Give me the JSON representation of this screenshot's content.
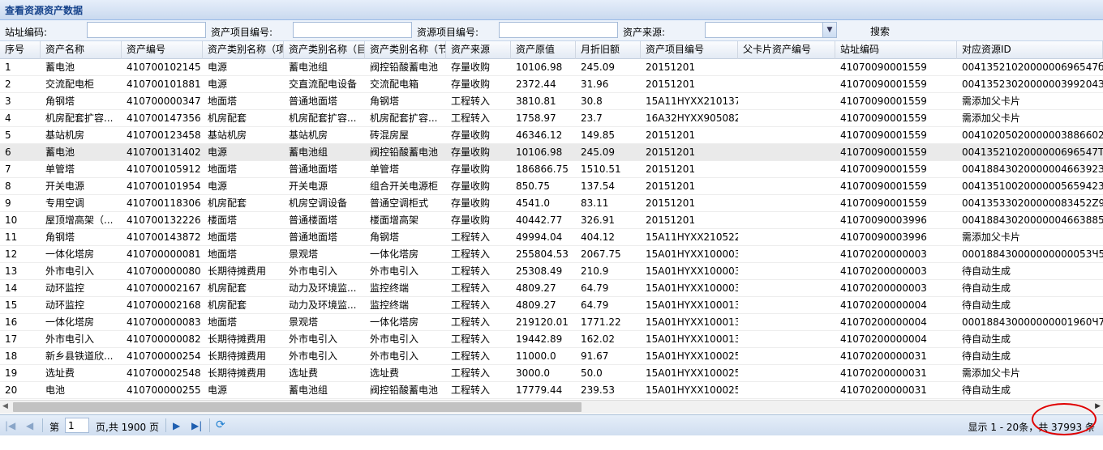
{
  "panel": {
    "title": "查看资源资产数据"
  },
  "search": {
    "site_code_label": "站址编码:",
    "asset_project_label": "资产项目编号:",
    "resource_project_label": "资源项目编号:",
    "asset_source_label": "资产来源:",
    "site_code_value": "",
    "asset_project_value": "",
    "resource_project_value": "",
    "asset_source_value": "",
    "search_label": "搜索"
  },
  "columns": [
    "序号",
    "资产名称",
    "资产编号",
    "资产类别名称（项",
    "资产类别名称（目",
    "资产类别名称（节",
    "资产来源",
    "资产原值",
    "月折旧额",
    "资产项目编号",
    "父卡片资产编号",
    "站址编码",
    "对应资源ID"
  ],
  "rows": [
    [
      "1",
      "蓄电池",
      "410700102145",
      "电源",
      "蓄电池组",
      "阀控铅酸蓄电池",
      "存量收购",
      "10106.98",
      "245.09",
      "20151201",
      "",
      "41070090001559",
      "0041352102000000696547б"
    ],
    [
      "2",
      "交流配电柜",
      "410700101881",
      "电源",
      "交直流配电设备",
      "交流配电箱",
      "存量收购",
      "2372.44",
      "31.96",
      "20151201",
      "",
      "41070090001559",
      "0041352302000000399204З6"
    ],
    [
      "3",
      "角钢塔",
      "410700000347",
      "地面塔",
      "普通地面塔",
      "角钢塔",
      "工程转入",
      "3810.81",
      "30.8",
      "15A11HYXX210137",
      "",
      "41070090001559",
      "需添加父卡片"
    ],
    [
      "4",
      "机房配套扩容...",
      "410700147356",
      "机房配套",
      "机房配套扩容...",
      "机房配套扩容...",
      "工程转入",
      "1758.97",
      "23.7",
      "16A32HYXX905082",
      "",
      "41070090001559",
      "需添加父卡片"
    ],
    [
      "5",
      "基站机房",
      "410700123458",
      "基站机房",
      "基站机房",
      "砖混房屋",
      "存量收购",
      "46346.12",
      "149.85",
      "20151201",
      "",
      "41070090001559",
      "00410205020000003886602б"
    ],
    [
      "6",
      "蓄电池",
      "410700131402",
      "电源",
      "蓄电池组",
      "阀控铅酸蓄电池",
      "存量收购",
      "10106.98",
      "245.09",
      "20151201",
      "",
      "41070090001559",
      "0041352102000000696547Т"
    ],
    [
      "7",
      "单管塔",
      "410700105912",
      "地面塔",
      "普通地面塔",
      "单管塔",
      "存量收购",
      "186866.75",
      "1510.51",
      "20151201",
      "",
      "41070090001559",
      "0041884302000000466392З"
    ],
    [
      "8",
      "开关电源",
      "410700101954",
      "电源",
      "开关电源",
      "组合开关电源柜",
      "存量收购",
      "850.75",
      "137.54",
      "20151201",
      "",
      "41070090001559",
      "00413510020000005659423"
    ],
    [
      "9",
      "专用空调",
      "410700118306",
      "机房配套",
      "机房空调设备",
      "普通空调柜式",
      "存量收购",
      "4541.0",
      "83.11",
      "20151201",
      "",
      "41070090001559",
      "004135330200000083452Z9"
    ],
    [
      "10",
      "屋顶增高架（...",
      "410700132226",
      "楼面塔",
      "普通楼面塔",
      "楼面增高架",
      "存量收购",
      "40442.77",
      "326.91",
      "20151201",
      "",
      "41070090003996",
      "00418843020000004663885Z"
    ],
    [
      "11",
      "角钢塔",
      "410700143872",
      "地面塔",
      "普通地面塔",
      "角钢塔",
      "工程转入",
      "49994.04",
      "404.12",
      "15A11HYXX210522",
      "",
      "41070090003996",
      "需添加父卡片"
    ],
    [
      "12",
      "一体化塔房",
      "410700000081",
      "地面塔",
      "景观塔",
      "一体化塔房",
      "工程转入",
      "255804.53",
      "2067.75",
      "15A01HYXX100003",
      "",
      "41070200000003",
      "000188430000000000053Ч5"
    ],
    [
      "13",
      "外市电引入",
      "410700000080",
      "长期待摊费用",
      "外市电引入",
      "外市电引入",
      "工程转入",
      "25308.49",
      "210.9",
      "15A01HYXX100003",
      "",
      "41070200000003",
      "待自动生成"
    ],
    [
      "14",
      "动环监控",
      "410700002167",
      "机房配套",
      "动力及环境监...",
      "监控终端",
      "工程转入",
      "4809.27",
      "64.79",
      "15A01HYXX100003",
      "",
      "41070200000003",
      "待自动生成"
    ],
    [
      "15",
      "动环监控",
      "410700002168",
      "机房配套",
      "动力及环境监...",
      "监控终端",
      "工程转入",
      "4809.27",
      "64.79",
      "15A01HYXX100013",
      "",
      "41070200000004",
      "待自动生成"
    ],
    [
      "16",
      "一体化塔房",
      "410700000083",
      "地面塔",
      "景观塔",
      "一体化塔房",
      "工程转入",
      "219120.01",
      "1771.22",
      "15A01HYXX100013",
      "",
      "41070200000004",
      "000188430000000001960Ч7"
    ],
    [
      "17",
      "外市电引入",
      "410700000082",
      "长期待摊费用",
      "外市电引入",
      "外市电引入",
      "工程转入",
      "19442.89",
      "162.02",
      "15A01HYXX100013",
      "",
      "41070200000004",
      "待自动生成"
    ],
    [
      "18",
      "新乡县铁道欣...",
      "410700000254",
      "长期待摊费用",
      "外市电引入",
      "外市电引入",
      "工程转入",
      "11000.0",
      "91.67",
      "15A01HYXX100025",
      "",
      "41070200000031",
      "待自动生成"
    ],
    [
      "19",
      "选址费",
      "410700002548",
      "长期待摊费用",
      "选址费",
      "选址费",
      "工程转入",
      "3000.0",
      "50.0",
      "15A01HYXX100025",
      "",
      "41070200000031",
      "需添加父卡片"
    ],
    [
      "20",
      "电池",
      "410700000255",
      "电源",
      "蓄电池组",
      "阀控铅酸蓄电池",
      "工程转入",
      "17779.44",
      "239.53",
      "15A01HYXX100025",
      "",
      "41070200000031",
      "待自动生成"
    ]
  ],
  "selected_row": 6,
  "pager": {
    "page_prefix": "第",
    "page_value": "1",
    "page_suffix": "页,共 1900 页",
    "info": "显示 1 - 20条，共 37993 条"
  }
}
